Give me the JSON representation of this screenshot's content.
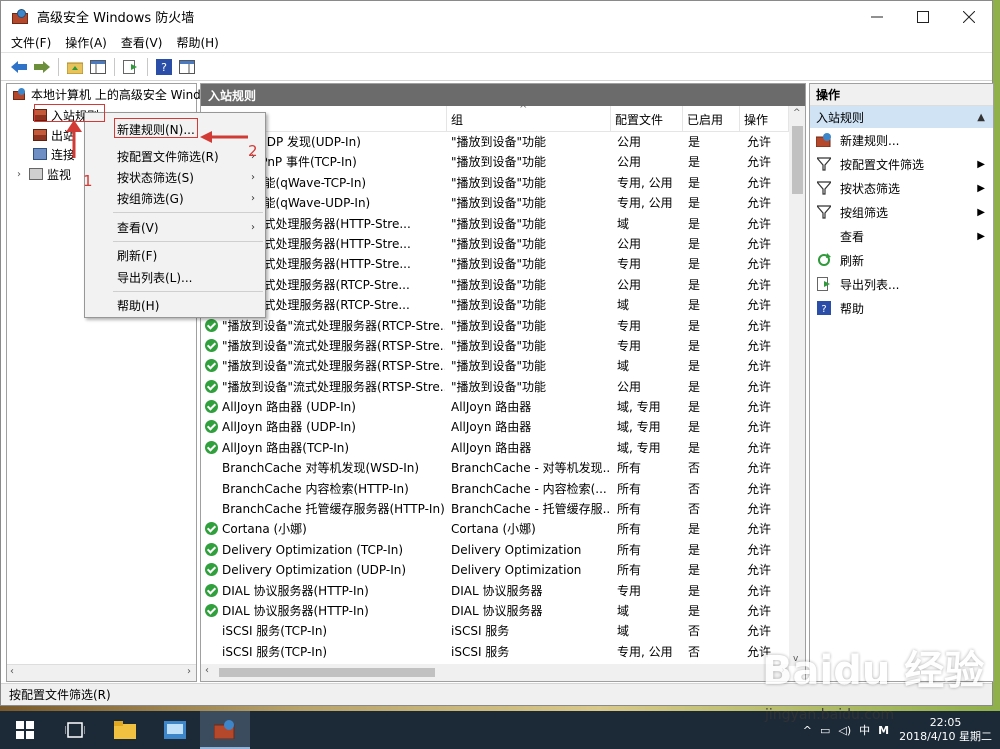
{
  "window": {
    "title": "高级安全 Windows 防火墙"
  },
  "menubar": [
    "文件(F)",
    "操作(A)",
    "查看(V)",
    "帮助(H)"
  ],
  "tree": {
    "root": "本地计算机 上的高级安全 Wind",
    "items": [
      "入站规则",
      "出站规则",
      "连接安全规则",
      "监视"
    ],
    "items_visible": [
      "入站规则",
      "出站",
      "连接",
      "监视"
    ]
  },
  "center": {
    "header": "入站规则",
    "columns": {
      "group": "组",
      "profile": "配置文件",
      "enabled": "已启用",
      "action": "操作"
    },
    "rows": [
      {
        "check": true,
        "name": "设备\"SSDP 发现(UDP-In)",
        "group": "\"播放到设备\"功能",
        "profile": "公用",
        "enabled": "是",
        "action": "允许"
      },
      {
        "check": true,
        "name": "设备\"UPnP 事件(TCP-In)",
        "group": "\"播放到设备\"功能",
        "profile": "公用",
        "enabled": "是",
        "action": "允许"
      },
      {
        "check": true,
        "name": "设备\"功能(qWave-TCP-In)",
        "group": "\"播放到设备\"功能",
        "profile": "专用, 公用",
        "enabled": "是",
        "action": "允许"
      },
      {
        "check": true,
        "name": "设备\"功能(qWave-UDP-In)",
        "group": "\"播放到设备\"功能",
        "profile": "专用, 公用",
        "enabled": "是",
        "action": "允许"
      },
      {
        "check": true,
        "name": "设备\"流式处理服务器(HTTP-Stre...",
        "group": "\"播放到设备\"功能",
        "profile": "域",
        "enabled": "是",
        "action": "允许"
      },
      {
        "check": true,
        "name": "设备\"流式处理服务器(HTTP-Stre...",
        "group": "\"播放到设备\"功能",
        "profile": "公用",
        "enabled": "是",
        "action": "允许"
      },
      {
        "check": true,
        "name": "设备\"流式处理服务器(HTTP-Stre...",
        "group": "\"播放到设备\"功能",
        "profile": "专用",
        "enabled": "是",
        "action": "允许"
      },
      {
        "check": true,
        "name": "设备\"流式处理服务器(RTCP-Stre...",
        "group": "\"播放到设备\"功能",
        "profile": "公用",
        "enabled": "是",
        "action": "允许"
      },
      {
        "check": true,
        "name": "设备\"流式处理服务器(RTCP-Stre...",
        "group": "\"播放到设备\"功能",
        "profile": "域",
        "enabled": "是",
        "action": "允许"
      },
      {
        "check": true,
        "name": "\"播放到设备\"流式处理服务器(RTCP-Stre...",
        "group": "\"播放到设备\"功能",
        "profile": "专用",
        "enabled": "是",
        "action": "允许"
      },
      {
        "check": true,
        "name": "\"播放到设备\"流式处理服务器(RTSP-Stre...",
        "group": "\"播放到设备\"功能",
        "profile": "专用",
        "enabled": "是",
        "action": "允许"
      },
      {
        "check": true,
        "name": "\"播放到设备\"流式处理服务器(RTSP-Stre...",
        "group": "\"播放到设备\"功能",
        "profile": "域",
        "enabled": "是",
        "action": "允许"
      },
      {
        "check": true,
        "name": "\"播放到设备\"流式处理服务器(RTSP-Stre...",
        "group": "\"播放到设备\"功能",
        "profile": "公用",
        "enabled": "是",
        "action": "允许"
      },
      {
        "check": true,
        "name": "AllJoyn 路由器 (UDP-In)",
        "group": "AllJoyn 路由器",
        "profile": "域, 专用",
        "enabled": "是",
        "action": "允许"
      },
      {
        "check": true,
        "name": "AllJoyn 路由器 (UDP-In)",
        "group": "AllJoyn 路由器",
        "profile": "域, 专用",
        "enabled": "是",
        "action": "允许"
      },
      {
        "check": true,
        "name": "AllJoyn 路由器(TCP-In)",
        "group": "AllJoyn 路由器",
        "profile": "域, 专用",
        "enabled": "是",
        "action": "允许"
      },
      {
        "check": false,
        "name": "BranchCache 对等机发现(WSD-In)",
        "group": "BranchCache - 对等机发现...",
        "profile": "所有",
        "enabled": "否",
        "action": "允许"
      },
      {
        "check": false,
        "name": "BranchCache 内容检索(HTTP-In)",
        "group": "BranchCache - 内容检索(...",
        "profile": "所有",
        "enabled": "否",
        "action": "允许"
      },
      {
        "check": false,
        "name": "BranchCache 托管缓存服务器(HTTP-In)",
        "group": "BranchCache - 托管缓存服...",
        "profile": "所有",
        "enabled": "否",
        "action": "允许"
      },
      {
        "check": true,
        "name": "Cortana (小娜)",
        "group": "Cortana (小娜)",
        "profile": "所有",
        "enabled": "是",
        "action": "允许"
      },
      {
        "check": true,
        "name": "Delivery Optimization (TCP-In)",
        "group": "Delivery Optimization",
        "profile": "所有",
        "enabled": "是",
        "action": "允许"
      },
      {
        "check": true,
        "name": "Delivery Optimization (UDP-In)",
        "group": "Delivery Optimization",
        "profile": "所有",
        "enabled": "是",
        "action": "允许"
      },
      {
        "check": true,
        "name": "DIAL 协议服务器(HTTP-In)",
        "group": "DIAL 协议服务器",
        "profile": "专用",
        "enabled": "是",
        "action": "允许"
      },
      {
        "check": true,
        "name": "DIAL 协议服务器(HTTP-In)",
        "group": "DIAL 协议服务器",
        "profile": "域",
        "enabled": "是",
        "action": "允许"
      },
      {
        "check": false,
        "name": "iSCSI 服务(TCP-In)",
        "group": "iSCSI 服务",
        "profile": "域",
        "enabled": "否",
        "action": "允许"
      },
      {
        "check": false,
        "name": "iSCSI 服务(TCP-In)",
        "group": "iSCSI 服务",
        "profile": "专用, 公用",
        "enabled": "否",
        "action": "允许"
      }
    ]
  },
  "actions": {
    "title": "操作",
    "section": "入站规则",
    "items": [
      {
        "label": "新建规则...",
        "icon": "new-rule-icon",
        "sub": false
      },
      {
        "label": "按配置文件筛选",
        "icon": "filter-icon",
        "sub": true
      },
      {
        "label": "按状态筛选",
        "icon": "filter-icon",
        "sub": true
      },
      {
        "label": "按组筛选",
        "icon": "filter-icon",
        "sub": true
      },
      {
        "label": "查看",
        "icon": "",
        "sub": true
      },
      {
        "label": "刷新",
        "icon": "refresh-icon",
        "sub": false
      },
      {
        "label": "导出列表...",
        "icon": "export-icon",
        "sub": false
      },
      {
        "label": "帮助",
        "icon": "help-icon",
        "sub": false
      }
    ]
  },
  "context_menu": {
    "items": [
      "新建规则(N)...",
      "按配置文件筛选(R)",
      "按状态筛选(S)",
      "按组筛选(G)",
      "查看(V)",
      "刷新(F)",
      "导出列表(L)...",
      "帮助(H)"
    ]
  },
  "annotations": {
    "num1": "1",
    "num2": "2"
  },
  "statusbar": "按配置文件筛选(R)",
  "taskbar": {
    "time": "22:05",
    "date": "2018/4/10 星期二",
    "ime": "中",
    "ime2": "M"
  },
  "watermark": {
    "main": "Baidu 经验",
    "sub": "jingyan.baidu.com"
  },
  "colors": {
    "accent": "#cfe3f5",
    "check": "#2fa03c",
    "annotation": "#d23a35"
  }
}
